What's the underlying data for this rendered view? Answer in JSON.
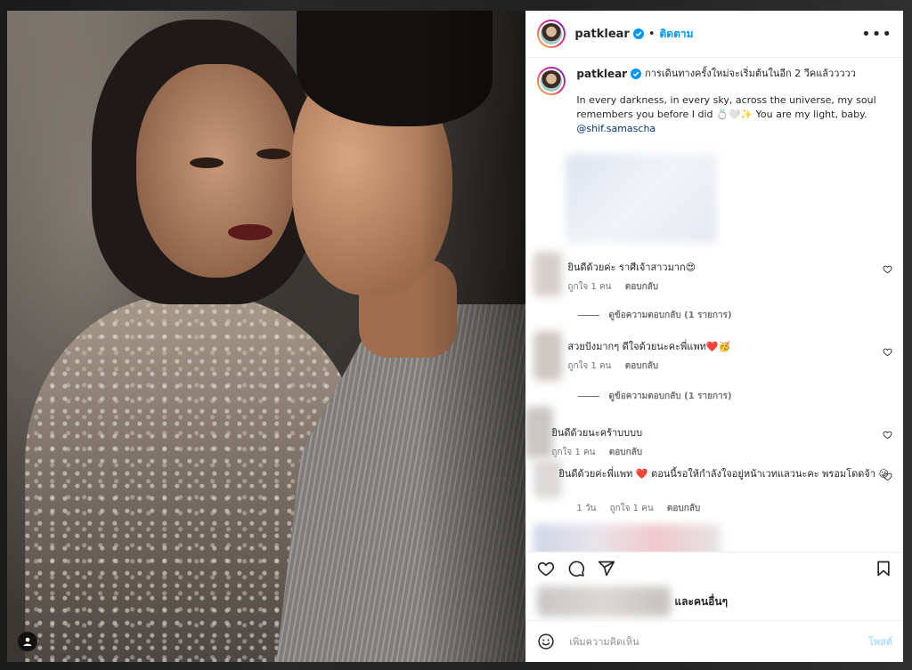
{
  "post": {
    "username": "patklear",
    "follow_label": "ติดตาม",
    "separator": "•",
    "more_label": "•••"
  },
  "caption": {
    "username": "patklear",
    "first_line": "การเดินทางครั้งใหม่จะเริ่มต้นในอีก 2 วีคแล้ววววว",
    "body": "In every darkness, in every sky, across the universe, my soul remembers you before I did 💍🤍✨ You are my light, baby.",
    "mention": "@shif.samascha"
  },
  "comments": [
    {
      "text": "ยินดีด้วยค่ะ ราศีเจ้าสาวมาก😍",
      "likes": "ถูกใจ 1 คน",
      "reply": "ตอบกลับ",
      "view_replies": "ดูข้อความตอบกลับ (1 รายการ)"
    },
    {
      "text": "สวยปังมากๆ ดีใจด้วยนะคะพี่แพท❤️🥳",
      "likes": "ถูกใจ 1 คน",
      "reply": "ตอบกลับ",
      "view_replies": "ดูข้อความตอบกลับ (1 รายการ)"
    },
    {
      "text": "ยินดีด้วยนะคร้าบบบบ",
      "likes": "ถูกใจ 1 คน",
      "reply": "ตอบกลับ"
    },
    {
      "text": "ยินดีด้วยค่ะพี่แพท ❤️ ตอนนี้รอให้กำลังใจอยู่หน้าเวทแลวนะคะ พรอมโดดจ้า ☺",
      "time": "1 วัน",
      "likes": "ถูกใจ 1 คน",
      "reply": "ตอบกลับ"
    }
  ],
  "likes_line": "และคนอื่นๆ",
  "add_comment": {
    "placeholder": "เพิ่มความคิดเห็น",
    "post_label": "โพสต์"
  },
  "colors": {
    "accent": "#0095f6",
    "post_disabled": "#b2dffc",
    "heart_red": "#ed4956"
  }
}
